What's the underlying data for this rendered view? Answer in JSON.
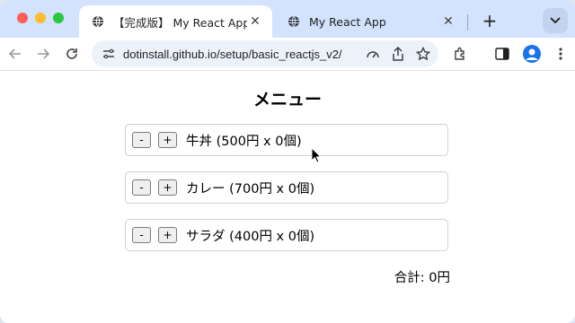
{
  "browser": {
    "tabs": [
      {
        "title": "【完成版】 My React App",
        "close_glyph": "✕",
        "active": true
      },
      {
        "title": "My React App",
        "close_glyph": "✕",
        "active": false
      }
    ],
    "new_tab_glyph": "+",
    "url": "dotinstall.github.io/setup/basic_reactjs_v2/",
    "icons": [
      "globe-icon",
      "back-icon",
      "forward-icon",
      "reload-icon",
      "site-info-icon",
      "performance-icon",
      "share-icon",
      "bookmark-star-icon",
      "extensions-icon",
      "side-panel-icon",
      "profile-icon",
      "more-menu-icon",
      "tab-search-icon"
    ],
    "accent_color": "#d3e3fd"
  },
  "page": {
    "title": "メニュー",
    "items": [
      {
        "minus": "-",
        "plus": "+",
        "label": "牛丼 (500円 x 0個)"
      },
      {
        "minus": "-",
        "plus": "+",
        "label": "カレー (700円 x 0個)"
      },
      {
        "minus": "-",
        "plus": "+",
        "label": "サラダ (400円 x 0個)"
      }
    ],
    "total": "合計: 0円"
  }
}
